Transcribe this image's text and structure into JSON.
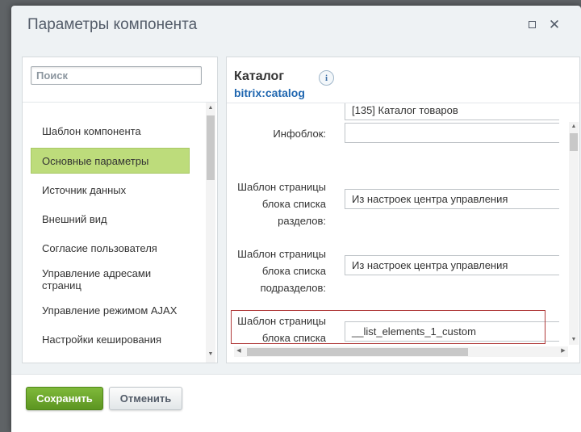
{
  "window": {
    "title": "Параметры компонента"
  },
  "sidebar": {
    "search_placeholder": "Поиск",
    "items": [
      {
        "label": "Шаблон компонента"
      },
      {
        "label": "Основные параметры",
        "active": true
      },
      {
        "label": "Источник данных"
      },
      {
        "label": "Внешний вид"
      },
      {
        "label": "Согласие пользователя"
      },
      {
        "label": "Управление адресами страниц"
      },
      {
        "label": "Управление режимом AJAX"
      },
      {
        "label": "Настройки кеширования"
      }
    ]
  },
  "component": {
    "title": "Каталог",
    "code": "bitrix:catalog"
  },
  "params": [
    {
      "label": "Инфоблок:",
      "value": "[135] Каталог товаров",
      "value2": ""
    },
    {
      "label": "Шаблон страницы блока списка разделов:",
      "value": "Из настроек центра управления"
    },
    {
      "label": "Шаблон страницы блока списка подразделов:",
      "value": "Из настроек центра управления"
    },
    {
      "label": "Шаблон страницы блока списка",
      "value": "__list_elements_1_custom"
    }
  ],
  "footer": {
    "save_label": "Сохранить",
    "cancel_label": "Отменить"
  },
  "colors": {
    "accent": "#bddc7b",
    "save": "#6aa62c",
    "link": "#2067b0",
    "highlight_border": "#b03a3a"
  }
}
